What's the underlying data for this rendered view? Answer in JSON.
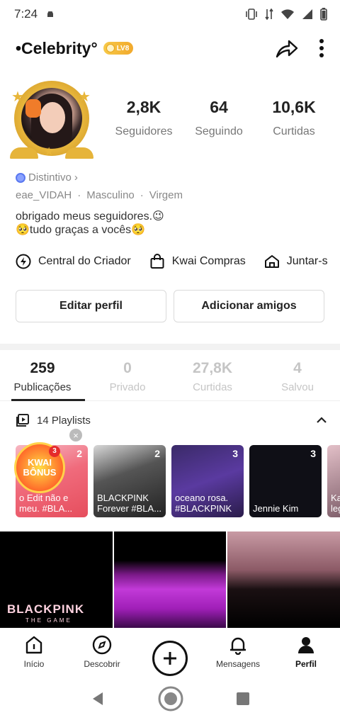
{
  "status_bar": {
    "time": "7:24"
  },
  "header": {
    "name": "•Celebrity°",
    "level_badge": "LV8"
  },
  "stats": [
    {
      "value": "2,8K",
      "label": "Seguidores"
    },
    {
      "value": "64",
      "label": "Seguindo"
    },
    {
      "value": "10,6K",
      "label": "Curtidas"
    }
  ],
  "profile": {
    "badge_label": "Distintivo",
    "username": "eae_VIDAH",
    "gender": "Masculino",
    "sign": "Virgem",
    "separator": "·",
    "bio_line1": "obrigado meus seguidores.😉",
    "bio_line2": "🥺tudo graças a vocês🥺"
  },
  "links": [
    {
      "label": "Central do Criador",
      "icon": "lightning-icon"
    },
    {
      "label": "Kwai Compras",
      "icon": "bag-icon"
    },
    {
      "label": "Juntar-s",
      "icon": "home-icon"
    }
  ],
  "buttons": {
    "edit": "Editar perfil",
    "add_friends": "Adicionar amigos"
  },
  "tabs": [
    {
      "count": "259",
      "label": "Publicações",
      "active": true
    },
    {
      "count": "0",
      "label": "Privado"
    },
    {
      "count": "27,8K",
      "label": "Curtidas"
    },
    {
      "count": "4",
      "label": "Salvou"
    }
  ],
  "playlists": {
    "header": "14 Playlists",
    "items": [
      {
        "count": "2",
        "title": "o Edit não e meu. #BLA..."
      },
      {
        "count": "2",
        "title": "BLACKPINK Forever #BLA..."
      },
      {
        "count": "3",
        "title": "oceano rosa. #BLACKPINK"
      },
      {
        "count": "3",
        "title": "Jennie Kim"
      },
      {
        "count": "",
        "title": "Kac leg"
      }
    ],
    "kwai_bonus": {
      "line1": "KWAI",
      "line2": "BÔNUS",
      "badge": "3"
    }
  },
  "grid": {
    "game_title": "BLACKPINK",
    "game_subtitle": "THE GAME"
  },
  "bottom_nav": [
    {
      "label": "Início",
      "icon": "home-outline-icon"
    },
    {
      "label": "Descobrir",
      "icon": "compass-icon"
    },
    {
      "label": "",
      "icon": "plus-icon"
    },
    {
      "label": "Mensagens",
      "icon": "bell-icon"
    },
    {
      "label": "Perfil",
      "icon": "person-icon",
      "active": true
    }
  ],
  "colors": {
    "accent": "#111111",
    "muted": "#c5c5c5",
    "badge_gold": "#f1a92c"
  }
}
